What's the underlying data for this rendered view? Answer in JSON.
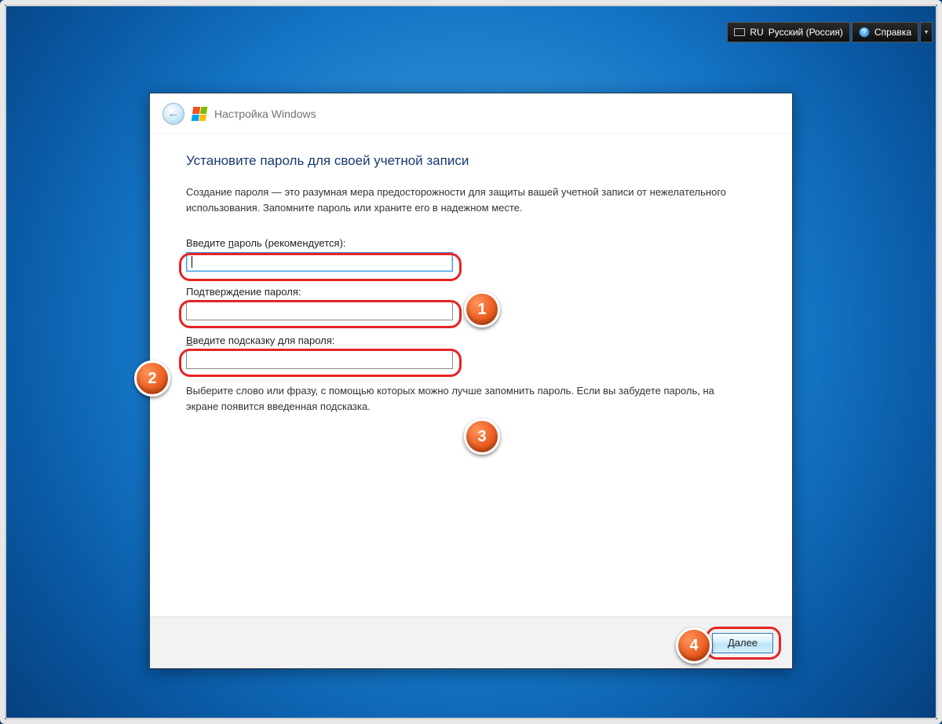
{
  "sysbar": {
    "lang_code": "RU",
    "lang_label": "Русский (Россия)",
    "help_label": "Справка"
  },
  "window": {
    "title": "Настройка Windows"
  },
  "page": {
    "heading": "Установите пароль для своей учетной записи",
    "description": "Создание пароля — это разумная мера предосторожности для защиты вашей учетной записи от нежелательного использования. Запомните пароль или храните его в надежном месте.",
    "password_label_pre": "Введите ",
    "password_label_u": "п",
    "password_label_post": "ароль (рекомендуется):",
    "confirm_label": "Подтверждение пароля:",
    "hint_label_pre": "",
    "hint_label_u": "В",
    "hint_label_post": "ведите подсказку для пароля:",
    "hint_description": "Выберите слово или фразу, с помощью которых можно лучше запомнить пароль. Если вы забудете пароль, на экране появится введенная подсказка.",
    "next_button": "Далее"
  },
  "annotations": {
    "badge1": "1",
    "badge2": "2",
    "badge3": "3",
    "badge4": "4"
  }
}
